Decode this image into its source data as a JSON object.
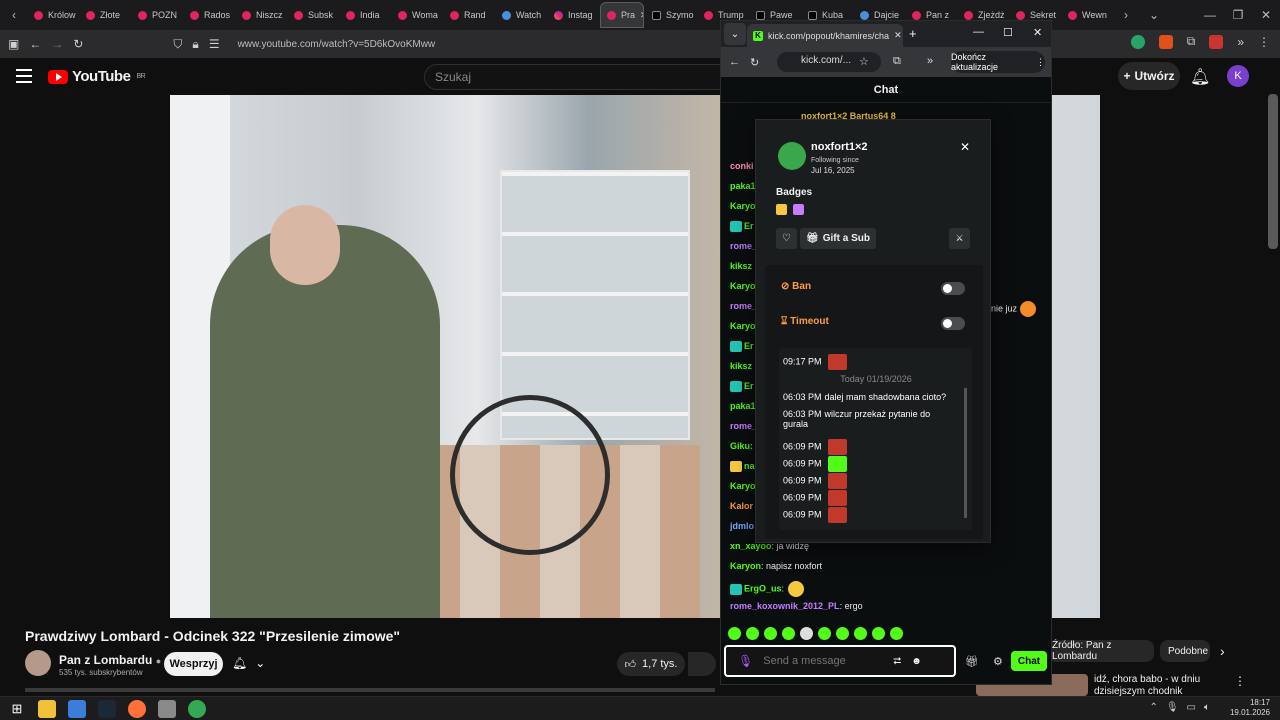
{
  "browser_tabs": [
    {
      "label": "Królow",
      "fav": "pink"
    },
    {
      "label": "Złote",
      "fav": "pink"
    },
    {
      "label": "POZN",
      "fav": "pink"
    },
    {
      "label": "Rados",
      "fav": "pink"
    },
    {
      "label": "Niszcz",
      "fav": "pink"
    },
    {
      "label": "Subsk",
      "fav": "pink"
    },
    {
      "label": "India",
      "fav": "pink"
    },
    {
      "label": "Woma",
      "fav": "pink"
    },
    {
      "label": "Rand",
      "fav": "pink"
    },
    {
      "label": "Watch",
      "fav": "g"
    },
    {
      "label": "Instag",
      "fav": "ig"
    },
    {
      "label": "Pra",
      "fav": "pink",
      "active": true
    },
    {
      "label": "Szymo",
      "fav": "x"
    },
    {
      "label": "Trump",
      "fav": "pink"
    },
    {
      "label": "Pawe",
      "fav": "x"
    },
    {
      "label": "Kuba",
      "fav": "x"
    },
    {
      "label": "Dajcie",
      "fav": "g"
    },
    {
      "label": "Pan z",
      "fav": "pink"
    },
    {
      "label": "Zjeżdż",
      "fav": "pink"
    },
    {
      "label": "Sekret",
      "fav": "pink"
    },
    {
      "label": "Wewn",
      "fav": "pink"
    }
  ],
  "address": {
    "url": "www.youtube.com/watch?v=5D6kOvoKMww"
  },
  "youtube": {
    "logo": "YouTube",
    "region": "BR",
    "search_placeholder": "Szukaj",
    "create_label": "Utwórz",
    "avatar_letter": "K",
    "video_title": "Prawdziwy Lombard - Odcinek 322 \"Przesilenie zimowe\"",
    "channel_name": "Pan z Lombardu",
    "subscribers": "535 tys. subskrybentów",
    "support_label": "Wesprzyj",
    "likes": "1,7 tys.",
    "chip_source": "Źródło: Pan z Lombardu",
    "chip_similar": "Podobne",
    "rec_title": "idź, chora babo - w dniu dzisiejszym chodnik nieszym..."
  },
  "kick": {
    "tab_title": "kick.com/popout/khamires/cha",
    "url": "kick.com/...",
    "update_label": "Dokończ aktualizacje",
    "chat_header": "Chat",
    "pinned": "noxfort1×2   Bartus64   8",
    "messages": [
      {
        "name": "conki",
        "text": "",
        "color": "#ff8fb1"
      },
      {
        "name": "paka1",
        "text": "",
        "color": "#53fc18"
      },
      {
        "name": "Karyo",
        "text": "",
        "color": "#53fc18"
      },
      {
        "name": "Er",
        "text": "",
        "color": "#53fc18"
      },
      {
        "name": "rome_",
        "text": "",
        "color": "#c57cff"
      },
      {
        "name": "kiksz",
        "text": "",
        "color": "#53fc18"
      },
      {
        "name": "Karyo",
        "text": "",
        "color": "#53fc18"
      },
      {
        "name": "rome_",
        "text": "",
        "color": "#c57cff"
      },
      {
        "name": "Karyo",
        "text": "",
        "color": "#53fc18"
      },
      {
        "name": "Er",
        "text": "",
        "color": "#53fc18"
      },
      {
        "name": "kiksz",
        "text": "",
        "color": "#53fc18"
      },
      {
        "name": "Er",
        "text": "",
        "color": "#53fc18"
      },
      {
        "name": "paka1",
        "text": "",
        "color": "#53fc18"
      },
      {
        "name": "rome_",
        "text": "",
        "color": "#c57cff"
      },
      {
        "name": "Giku:",
        "text": "",
        "color": "#53fc18"
      },
      {
        "name": "na",
        "text": "",
        "color": "#53fc18"
      },
      {
        "name": "Karyo",
        "text": "",
        "color": "#53fc18"
      },
      {
        "name": "Kalor",
        "text": "",
        "color": "#ff9c47"
      },
      {
        "name": "jdmlo",
        "text": "",
        "color": "#7aa7ff"
      },
      {
        "name": "xn_xayoo",
        "text": ": ja widzę",
        "color": "#53fc18"
      },
      {
        "name": "Karyon",
        "text": ": napisz noxfort",
        "color": "#53fc18"
      },
      {
        "name": "ErgO_us",
        "text": ":",
        "color": "#53fc18"
      },
      {
        "name": "rome_koxownik_2012_PL",
        "text": ": ergo",
        "color": "#c57cff"
      }
    ],
    "side_text": "nie juz",
    "input_placeholder": "Send a message",
    "send_label": "Chat"
  },
  "usercard": {
    "username": "noxfort1×2",
    "following_label": "Following since",
    "following_date": "Jul 16, 2025",
    "badges_label": "Badges",
    "gift_label": "Gift a Sub",
    "ban_label": "Ban",
    "timeout_label": "Timeout",
    "history": [
      {
        "time": "09:17 PM",
        "text": "",
        "emote": true
      },
      {
        "time": "06:03 PM",
        "text": "dalej mam shadowbana cioto?",
        "emote": false
      },
      {
        "time": "06:03 PM",
        "text": "wilczur przekaż pytanie do",
        "text2": "gurala",
        "emote": false
      },
      {
        "time": "06:09 PM",
        "text": "",
        "emote": true
      },
      {
        "time": "06:09 PM",
        "text": "",
        "emote": true,
        "green": true
      },
      {
        "time": "06:09 PM",
        "text": "",
        "emote": true
      },
      {
        "time": "06:09 PM",
        "text": "",
        "emote": true
      },
      {
        "time": "06:09 PM",
        "text": "",
        "emote": true
      }
    ],
    "history_separator": "Today 01/19/2026"
  },
  "taskbar": {
    "time": "18:17",
    "date": "19.01.2026"
  }
}
